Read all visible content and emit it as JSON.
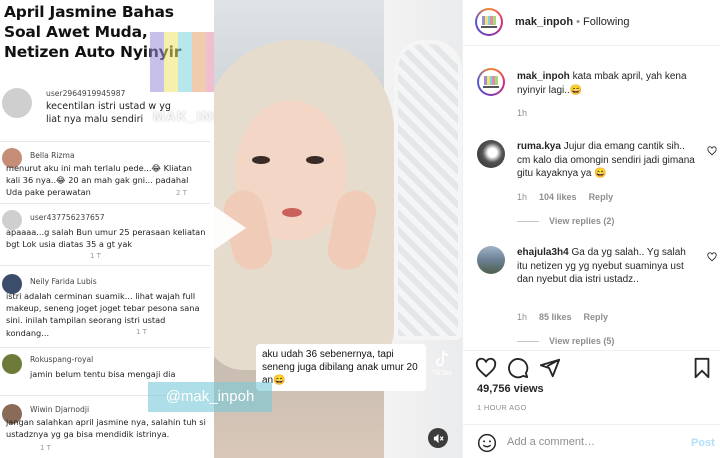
{
  "media": {
    "headline": "April Jasmine Bahas Soal Awet Muda, Netizen Auto Nyinyir",
    "watermark": "MAK_INPOH",
    "comments": [
      {
        "user": "user2964919945987",
        "text": "kecentilan istri ustad w yg liat nya malu sendiri",
        "meta": ""
      },
      {
        "user": "Bella Rizma",
        "text": "menurut aku ini mah terlalu pede...😂 Kliatan kali 36 nya..😂 20 an mah gak gni... padahal Uda pake perawatan",
        "meta": "2 T"
      },
      {
        "user": "user437756237657",
        "text": "apaaaa...g salah Bun umur 25 perasaan keliatan bgt Lok usia diatas 35 a gt yak",
        "meta": "1 T"
      },
      {
        "user": "Neily Farida Lubis",
        "text": "istri adalah cerminan suamik... lihat wajah full makeup, seneng joget joget tebar pesona sana sini. inilah tampilan seorang istri ustad kondang...",
        "meta": "1 T"
      },
      {
        "user": "Rokuspang-royal",
        "text": "jamin belum tentu bisa mengaji dia",
        "meta": "1"
      },
      {
        "user": "Wiwin Djarnodji",
        "text": "jangan salahkan april jasmine nya, salahin tuh si ustadznya yg ga bisa mendidik istrinya.",
        "meta": "1 T"
      }
    ],
    "video_caption": "aku udah 36 sebenernya, tapi seneng juga dibilang anak umur 20 an😄",
    "video_watermark": "@mak_inpoh",
    "tiktok_label": "TikTok"
  },
  "header": {
    "username": "mak_inpoh",
    "separator": " • ",
    "follow_status": "Following"
  },
  "caption": {
    "username": "mak_inpoh",
    "text": "kata mbak april, yah kena nyinyir lagi..😄",
    "time": "1h"
  },
  "comments": [
    {
      "username": "ruma.kya",
      "text": "Jujur dia emang cantik sih.. cm kalo dia omongin sendiri jadi gimana gitu kayaknya ya 😄",
      "time": "1h",
      "likes": "104 likes",
      "reply": "Reply",
      "view_replies": "View replies (2)"
    },
    {
      "username": "ehajula3h4",
      "text": "Ga da yg salah.. Yg salah itu netizen yg yg nyebut suaminya ust dan nyebut dia istri ustadz..",
      "time": "1h",
      "likes": "85 likes",
      "reply": "Reply",
      "view_replies": "View replies (5)"
    }
  ],
  "actions": {
    "views": "49,756 views",
    "posted": "1 HOUR AGO"
  },
  "add_comment": {
    "placeholder": "Add a comment…",
    "post_label": "Post"
  },
  "colors": {
    "accent": "#0095f6",
    "post_disabled": "#b2dffc",
    "muted": "#8e8e8e"
  }
}
